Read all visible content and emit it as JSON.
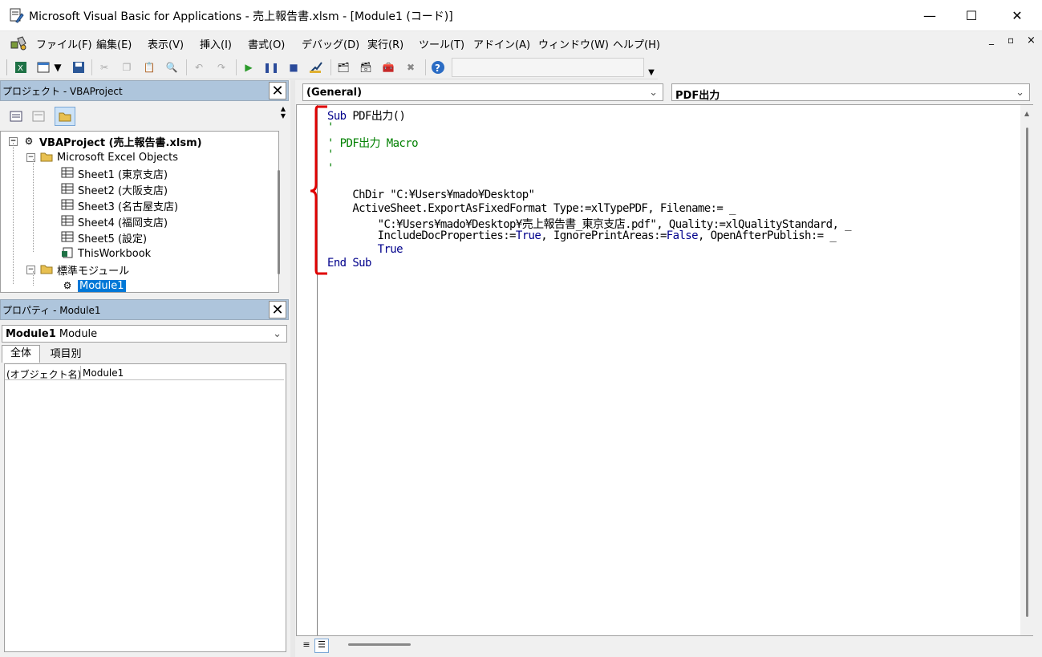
{
  "window": {
    "title": "Microsoft Visual Basic for Applications - 売上報告書.xlsm - [Module1 (コード)]",
    "minimize": "—",
    "maximize": "☐",
    "close": "✕"
  },
  "menu": {
    "items": [
      {
        "label": "ファイル(F)"
      },
      {
        "label": "編集(E)"
      },
      {
        "label": "表示(V)"
      },
      {
        "label": "挿入(I)"
      },
      {
        "label": "書式(O)"
      },
      {
        "label": "デバッグ(D)"
      },
      {
        "label": "実行(R)"
      },
      {
        "label": "ツール(T)"
      },
      {
        "label": "アドイン(A)"
      },
      {
        "label": "ウィンドウ(W)"
      },
      {
        "label": "ヘルプ(H)"
      }
    ],
    "child_min": "_",
    "child_restore": "▫",
    "child_close": "×"
  },
  "project_pane": {
    "title": "プロジェクト - VBAProject",
    "close": "✕",
    "tree": [
      {
        "label": "VBAProject (売上報告書.xlsm)",
        "bold": true
      },
      {
        "label": "Microsoft Excel Objects"
      },
      {
        "label": "Sheet1 (東京支店)"
      },
      {
        "label": "Sheet2 (大阪支店)"
      },
      {
        "label": "Sheet3 (名古屋支店)"
      },
      {
        "label": "Sheet4 (福岡支店)"
      },
      {
        "label": "Sheet5 (設定)"
      },
      {
        "label": "ThisWorkbook"
      },
      {
        "label": "標準モジュール"
      },
      {
        "label": "Module1",
        "selected": true
      }
    ]
  },
  "properties_pane": {
    "title": "プロパティ - Module1",
    "close": "✕",
    "object_name": "Module1",
    "object_type": "Module",
    "tabs": [
      "全体",
      "項目別"
    ],
    "rows": [
      {
        "name": "(オブジェクト名)",
        "value": "Module1"
      }
    ]
  },
  "code_window": {
    "object_dropdown": "(General)",
    "proc_dropdown": "PDF出力",
    "lines": [
      {
        "kw": "Sub",
        "rest": " PDF出力()"
      },
      {
        "cm": "'"
      },
      {
        "cm": "' PDF出力 Macro"
      },
      {
        "cm": "'"
      },
      {
        "cm": "'"
      },
      {
        "plain": "    ChDir \"C:¥Users¥mado¥Desktop\""
      },
      {
        "plain": "    ActiveSheet.ExportAsFixedFormat Type:=xlTypePDF, Filename:= _"
      },
      {
        "plain": "        \"C:¥Users¥mado¥Desktop¥売上報告書_東京支店.pdf\", Quality:=xlQualityStandard, _"
      },
      {
        "pre": "        IncludeDocProperties:=",
        "kw": "True",
        "mid": ", IgnorePrintAreas:=",
        "kw2": "False",
        "post": ", OpenAfterPublish:= _"
      },
      {
        "pre": "        ",
        "kw": "True"
      },
      {
        "kw": "End Sub"
      }
    ]
  },
  "colors": {
    "keyword": "#00008b",
    "comment": "#008000",
    "bracket": "#e00000",
    "pane_header": "#aec5dc",
    "selection": "#0078d7"
  }
}
